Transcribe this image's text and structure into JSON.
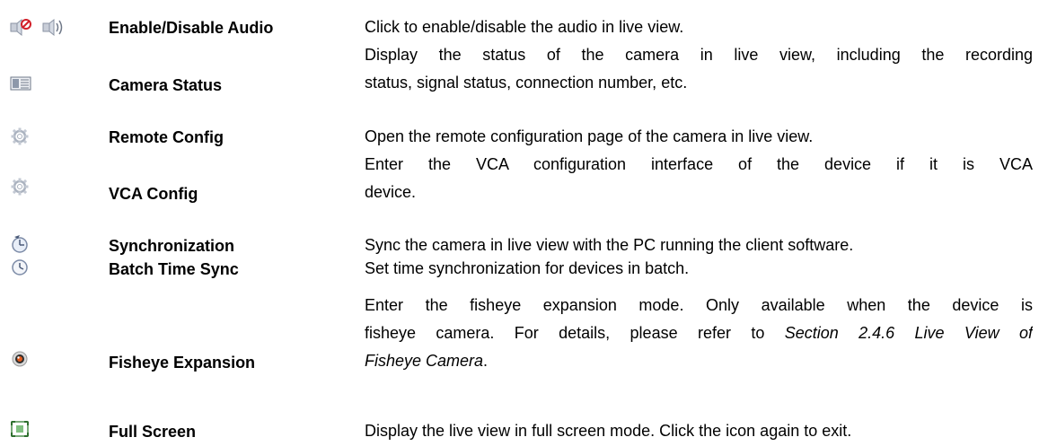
{
  "rows": [
    {
      "icons": [
        "audio-disable-icon",
        "audio-enable-icon"
      ],
      "name": "Enable/Disable Audio",
      "lines": [
        "Click to enable/disable the audio in live view."
      ]
    },
    {
      "icons": [
        "camera-status-icon"
      ],
      "name": "Camera Status",
      "lines": [
        "Display the status of the camera in live view, including the recording",
        "status, signal status, connection number, etc."
      ]
    },
    {
      "icons": [
        "remote-config-gear-icon"
      ],
      "name": "Remote Config",
      "lines": [
        "Open the remote configuration page of the camera in live view."
      ]
    },
    {
      "icons": [
        "vca-config-gear-icon"
      ],
      "name": "VCA Config",
      "lines": [
        "Enter the VCA configuration interface of the device if it is VCA",
        "device."
      ]
    },
    {
      "icons": [
        "synchronization-clock-icon"
      ],
      "name": "Synchronization",
      "lines": [
        "Sync the camera in live view with the PC running the client software."
      ]
    },
    {
      "icons": [
        "batch-time-sync-clock-icon"
      ],
      "name": "Batch Time Sync",
      "lines": [
        "Set time synchronization for devices in batch."
      ]
    },
    {
      "icons": [
        "fisheye-expansion-icon"
      ],
      "name": "Fisheye Expansion",
      "lines": [
        "Enter the fisheye expansion mode. Only available when the device is",
        "fisheye camera. For details, please refer to",
        "Fisheye Camera",
        "."
      ],
      "ref_section": "Section 2.4.6 Live View of"
    },
    {
      "icons": [
        "full-screen-icon"
      ],
      "name": "Full Screen",
      "lines": [
        "Display the live view in full screen mode. Click the icon again to exit."
      ]
    }
  ]
}
